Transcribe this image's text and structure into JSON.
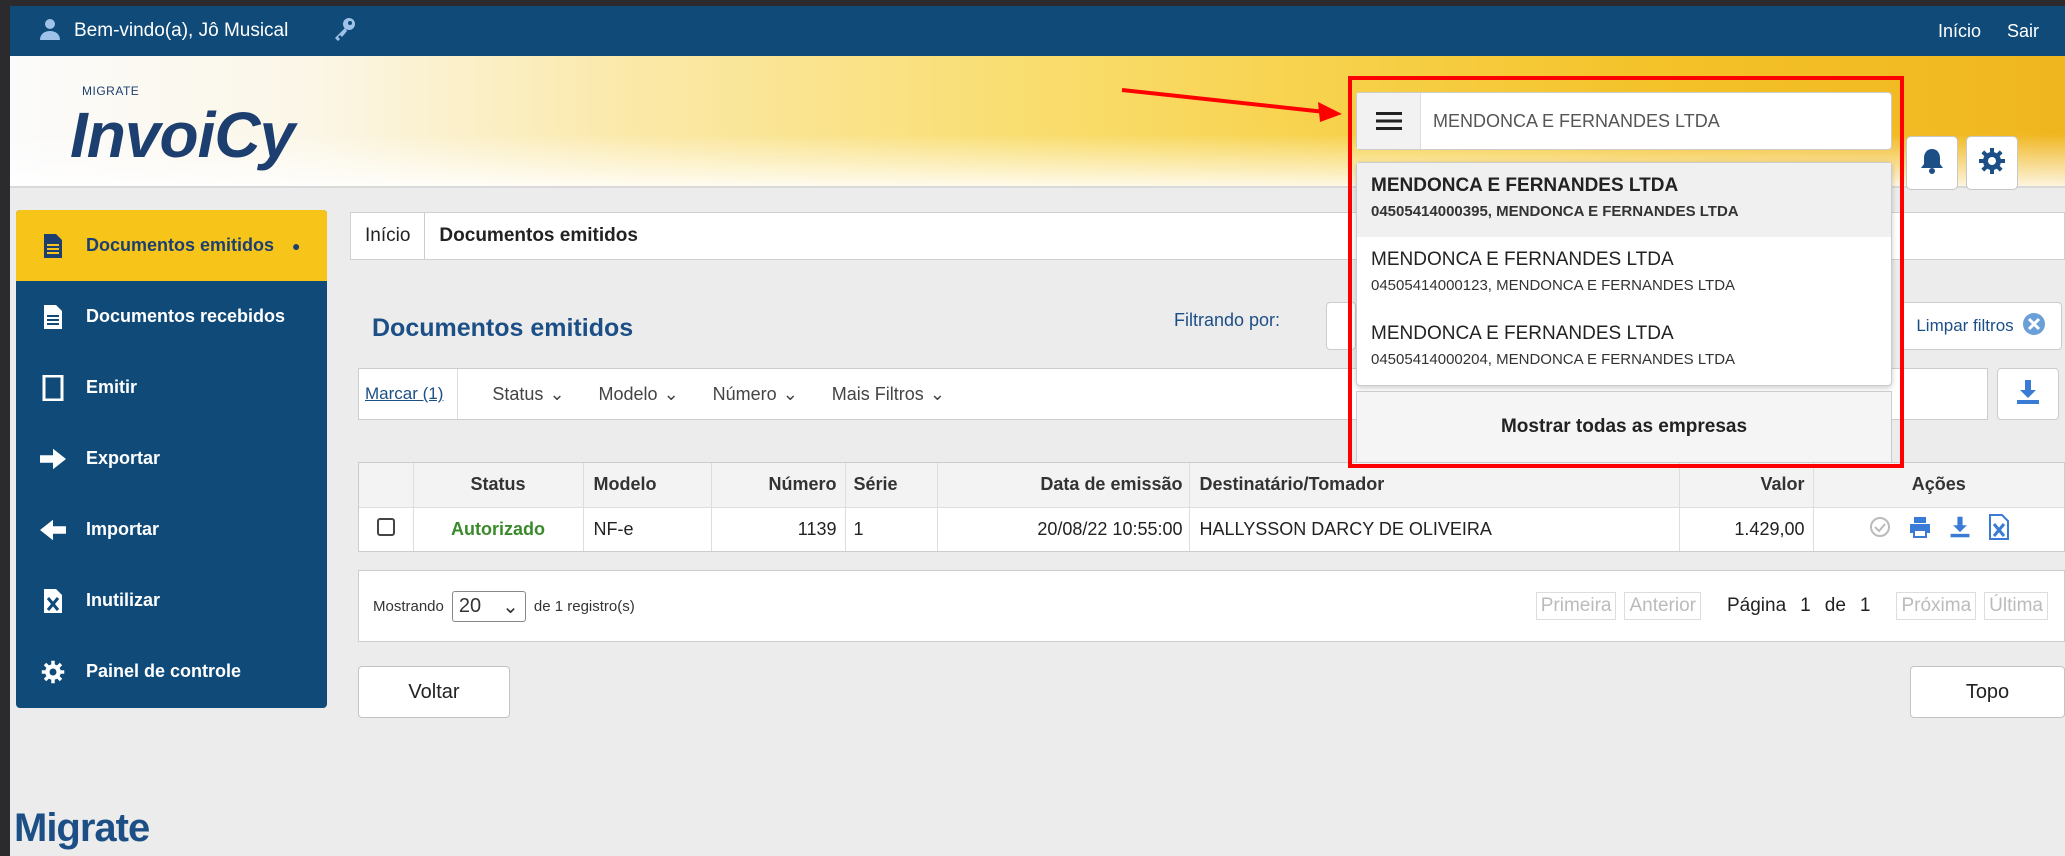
{
  "topbar": {
    "welcome": "Bem-vindo(a), Jô Musical",
    "links": [
      "Início",
      "Sair"
    ]
  },
  "logo": {
    "brand_small": "MIGRATE",
    "brand": "InvoiCy"
  },
  "sidebar": {
    "items": [
      {
        "label": "Documentos emitidos",
        "icon": "document-icon",
        "active": true
      },
      {
        "label": "Documentos recebidos",
        "icon": "document-icon"
      },
      {
        "label": "Emitir",
        "icon": "page-icon"
      },
      {
        "label": "Exportar",
        "icon": "arrow-right-icon"
      },
      {
        "label": "Importar",
        "icon": "arrow-left-icon"
      },
      {
        "label": "Inutilizar",
        "icon": "cancel-doc-icon"
      },
      {
        "label": "Painel de controle",
        "icon": "gear-icon"
      }
    ]
  },
  "breadcrumb": [
    "Início",
    "Documentos emitidos"
  ],
  "main": {
    "title": "Documentos emitidos",
    "filter_label": "Filtrando por:",
    "clear_filters": "Limpar filtros"
  },
  "toolbar": {
    "mark": "Marcar (1)",
    "dropdowns": [
      "Status",
      "Modelo",
      "Número",
      "Mais Filtros"
    ]
  },
  "table": {
    "headers": [
      "Status",
      "Modelo",
      "Número",
      "Série",
      "Data de emissão",
      "Destinatário/Tomador",
      "Valor",
      "Ações"
    ],
    "rows": [
      {
        "status": "Autorizado",
        "modelo": "NF-e",
        "numero": "1139",
        "serie": "1",
        "data": "20/08/22 10:55:00",
        "destinatario": "HALLYSSON DARCY DE OLIVEIRA",
        "valor": "1.429,00"
      }
    ]
  },
  "pager": {
    "showing": "Mostrando",
    "page_size": "20",
    "of_records": "de 1  registro(s)",
    "first": "Primeira",
    "prev": "Anterior",
    "page_label": "Página",
    "page": "1",
    "of": "de",
    "total": "1",
    "next": "Próxima",
    "last": "Última"
  },
  "buttons": {
    "back": "Voltar",
    "top": "Topo"
  },
  "footer_logo": "Migrate",
  "company_search": {
    "value": "MENDONCA E FERNANDES LTDA",
    "suggestions": [
      {
        "name": "MENDONCA E FERNANDES LTDA",
        "detail": "04505414000395, MENDONCA E FERNANDES LTDA"
      },
      {
        "name": "MENDONCA E FERNANDES LTDA",
        "detail": "04505414000123, MENDONCA E FERNANDES LTDA"
      },
      {
        "name": "MENDONCA E FERNANDES LTDA",
        "detail": "04505414000204, MENDONCA E FERNANDES LTDA"
      }
    ],
    "show_all": "Mostrar todas as empresas"
  },
  "colors": {
    "nav_blue": "#0f4a78",
    "active_yellow": "#f7c51a",
    "status_green": "#3a8a2b",
    "annotation_red": "#ff0000"
  }
}
